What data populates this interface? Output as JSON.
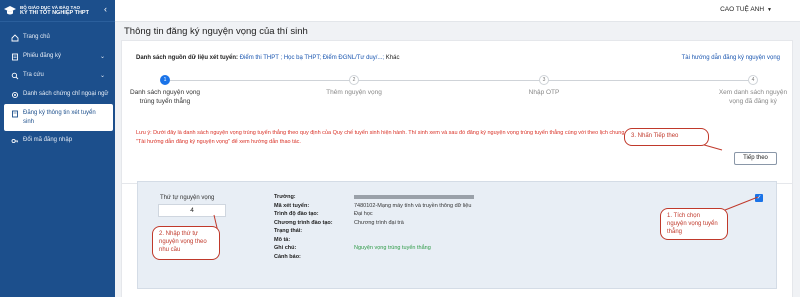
{
  "sidebar": {
    "logo_line1": "BỘ GIÁO DỤC VÀ ĐÀO TẠO",
    "logo_line2": "KỲ THI TỐT NGHIỆP THPT",
    "collapse_icon": "chevron-left-icon",
    "items": [
      {
        "label": "Trang chủ",
        "icon": "home-icon"
      },
      {
        "label": "Phiếu đăng ký",
        "icon": "form-icon",
        "has_chevron": true
      },
      {
        "label": "Tra cứu",
        "icon": "search-icon",
        "has_chevron": true
      },
      {
        "label": "Danh sách chứng chỉ ngoại ngữ",
        "icon": "certificate-icon"
      },
      {
        "label": "Đăng ký thông tin xét tuyển sinh",
        "icon": "document-icon",
        "active": true
      },
      {
        "label": "Đổi mã đăng nhập",
        "icon": "key-icon"
      }
    ]
  },
  "header": {
    "user_name": "CAO TUỆ ANH"
  },
  "page": {
    "title": "Thông tin đăng ký nguyện vọng của thí sinh"
  },
  "sources": {
    "label": "Danh sách nguồn dữ liệu xét tuyển:",
    "links": "Điểm thi THPT ; Học bạ THPT; Điểm ĐGNL/Tư duy/...;",
    "more": "Khác",
    "guide_link": "Tài hướng dẫn đăng ký nguyện vọng"
  },
  "stepper": {
    "steps": [
      {
        "num": "1",
        "label": "Danh sách nguyện vọng trúng tuyển thẳng",
        "active": true
      },
      {
        "num": "2",
        "label": "Thêm nguyện vọng",
        "active": false
      },
      {
        "num": "3",
        "label": "Nhập OTP",
        "active": false
      },
      {
        "num": "4",
        "label": "Xem danh sách nguyện vọng đã đăng ký",
        "active": false
      }
    ]
  },
  "note": {
    "line1": "Lưu ý: Dưới đây là danh sách nguyện vọng trúng tuyển thẳng theo quy định của Quy chế tuyển sinh hiện hành. Thí sinh xem và sau đó đăng ký nguyện vọng trúng tuyển thẳng cùng với",
    "line1_tail": "theo lịch chung. Thí sinh bấm",
    "line2": "\"Tài hướng dẫn đăng ký nguyện vọng\" để xem hướng dẫn thao tác."
  },
  "actions": {
    "next_label": "Tiếp theo"
  },
  "wish": {
    "order_label": "Thứ tự nguyện vọng",
    "order_value": "4",
    "fields": [
      {
        "key": "Trường:",
        "value": "",
        "redacted": true
      },
      {
        "key": "Mã xét tuyển:",
        "value": "7480102-Mạng máy tính và truyền thông dữ liệu"
      },
      {
        "key": "Trình độ đào tạo:",
        "value": "Đại học"
      },
      {
        "key": "Chương trình đào tạo:",
        "value": "Chương trình đại trà"
      },
      {
        "key": "Trạng thái:",
        "value": ""
      },
      {
        "key": "Mô tả:",
        "value": ""
      },
      {
        "key": "Ghi chú:",
        "value": "Nguyện vọng trúng tuyển thẳng",
        "green": true
      },
      {
        "key": "Cảnh báo:",
        "value": ""
      }
    ],
    "checked": true
  },
  "callouts": {
    "c1": "1. Tích chọn nguyện vọng tuyển thẳng",
    "c2": "2. Nhập thứ tự nguyện vọng theo nhu cầu",
    "c3": "3. Nhấn Tiếp theo"
  },
  "colors": {
    "sidebar_bg": "#1c4f8c",
    "accent": "#1a73e8",
    "callout_red": "#c0392b",
    "note_red": "#d93025",
    "green": "#2e9b47"
  }
}
